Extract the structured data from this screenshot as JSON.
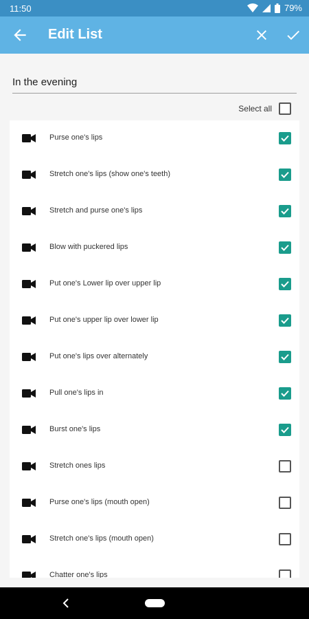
{
  "status_bar": {
    "time": "11:50",
    "battery": "79%"
  },
  "app_bar": {
    "title": "Edit List",
    "back_icon": "arrow-left-icon",
    "close_icon": "close-icon",
    "confirm_icon": "check-icon"
  },
  "list_name": {
    "value": "In the evening"
  },
  "select_all": {
    "label": "Select all",
    "checked": false
  },
  "colors": {
    "status_bar": "#3b8fc4",
    "app_bar": "#5fb3e4",
    "checkbox_checked": "#1a9c8c"
  },
  "items": [
    {
      "label": "Purse one's lips",
      "checked": true
    },
    {
      "label": "Stretch one's lips (show one's teeth)",
      "checked": true
    },
    {
      "label": "Stretch and purse one's lips",
      "checked": true
    },
    {
      "label": "Blow with puckered lips",
      "checked": true
    },
    {
      "label": "Put one's Lower lip over upper lip",
      "checked": true
    },
    {
      "label": "Put one's upper lip over lower lip",
      "checked": true
    },
    {
      "label": "Put one's lips over alternately",
      "checked": true
    },
    {
      "label": "Pull one's lips in",
      "checked": true
    },
    {
      "label": "Burst one's lips",
      "checked": true
    },
    {
      "label": "Stretch ones lips",
      "checked": false
    },
    {
      "label": "Purse one's lips (mouth open)",
      "checked": false
    },
    {
      "label": "Stretch one's lips (mouth open)",
      "checked": false
    },
    {
      "label": "Chatter one's lips",
      "checked": false
    }
  ]
}
